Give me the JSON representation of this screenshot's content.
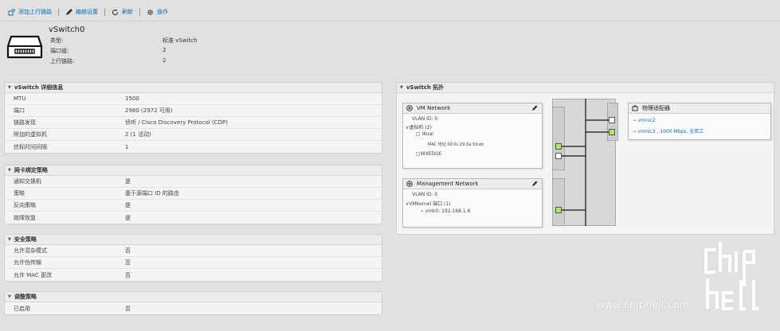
{
  "toolbar": {
    "add_uplink": "添加上行链路",
    "edit_settings": "编辑设置",
    "refresh": "刷新",
    "actions": "操作"
  },
  "header": {
    "title": "vSwitch0",
    "props": [
      {
        "label": "类型:",
        "value": "标准 vSwitch"
      },
      {
        "label": "端口组:",
        "value": "2"
      },
      {
        "label": "上行链路:",
        "value": "2"
      }
    ]
  },
  "details": {
    "title": "vSwitch 详细信息",
    "rows": [
      {
        "label": "MTU",
        "value": "1500"
      },
      {
        "label": "端口",
        "value": "2980 (2972 可用)"
      },
      {
        "label": "链路发现",
        "value": "侦听 / Cisco Discovery Protocol (CDP)"
      },
      {
        "label": "附加的虚拟机",
        "value": "2 (1 活动)"
      },
      {
        "label": "信标时间间隔",
        "value": "1"
      }
    ]
  },
  "nic_teaming": {
    "title": "网卡绑定策略",
    "rows": [
      {
        "label": "通知交换机",
        "value": "是"
      },
      {
        "label": "策略",
        "value": "基于源端口 ID 的路由"
      },
      {
        "label": "反向策略",
        "value": "是"
      },
      {
        "label": "故障恢复",
        "value": "是"
      }
    ]
  },
  "security": {
    "title": "安全策略",
    "rows": [
      {
        "label": "允许混杂模式",
        "value": "否"
      },
      {
        "label": "允许伪传输",
        "value": "否"
      },
      {
        "label": "允许 MAC 更改",
        "value": "否"
      }
    ]
  },
  "shaping": {
    "title": "调整策略",
    "rows": [
      {
        "label": "已启用",
        "value": "否"
      }
    ]
  },
  "topology": {
    "title": "vSwitch 拓扑",
    "vm_network": {
      "name": "VM Network",
      "vlan": "VLAN ID: 0",
      "vms_label": "虚拟机 (2)",
      "vm1": "iKuai",
      "vm1_mac": "MAC 地址 00:0c:29:3a:59:eb",
      "vm2": "WXEDGE"
    },
    "mgmt_network": {
      "name": "Management Network",
      "vlan": "VLAN ID: 0",
      "vmk_label": "VMkernel 端口 (1)",
      "vmk0": "vmk0: 192.168.1.6"
    },
    "adapters": {
      "title": "物理适配器",
      "nic1": "vmnic2",
      "nic2": "vmnic3 , 1000 Mbps, 全双工"
    }
  },
  "watermark": {
    "url": "www.chiphell.com",
    "logo": "chip hell"
  },
  "colors": {
    "link": "#0a6fb5",
    "port_active": "#b3e36d",
    "background": "#e1e1e1"
  }
}
